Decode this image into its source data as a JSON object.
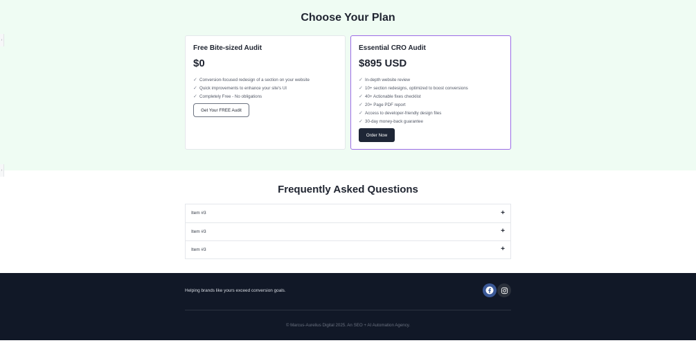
{
  "pricing": {
    "title": "Choose Your Plan",
    "plans": [
      {
        "name": "Free Bite-sized Audit",
        "price": "$0",
        "features": [
          "Conversion-focused redesign of a section on your website",
          "Quick improvements to enhance your site's UI",
          "Completely Free - No obligations"
        ],
        "cta": "Get Your FREE Audit"
      },
      {
        "name": "Essential CRO Audit",
        "price": "$895 USD",
        "features": [
          "In-depth website review",
          "10+ section redesigns, optimized to boost conversions",
          "40+ Actionable fixes checklist",
          "20+ Page PDF report",
          "Access to developer-friendly design files",
          "30-day money-back guarantee"
        ],
        "cta": "Order Now",
        "highlight_color": "#9b6ae6"
      }
    ]
  },
  "edge_tabs": [
    "›",
    "›"
  ],
  "faq": {
    "title": "Frequently Asked Questions",
    "items": [
      "Item #3",
      "Item #3",
      "Item #3"
    ],
    "toggle_symbol": "+"
  },
  "footer": {
    "tagline": "Helping brands like yours exceed conversion goals.",
    "social": [
      "facebook-icon",
      "instagram-icon"
    ],
    "copyright": "© Marcus-Aurelius Digital 2025. An SEO + AI Automation Agency."
  },
  "colors": {
    "pricing_bg": "#effcf3",
    "footer_bg": "#111827",
    "button_dark": "#1e2636",
    "accent_purple": "#9b6ae6"
  }
}
